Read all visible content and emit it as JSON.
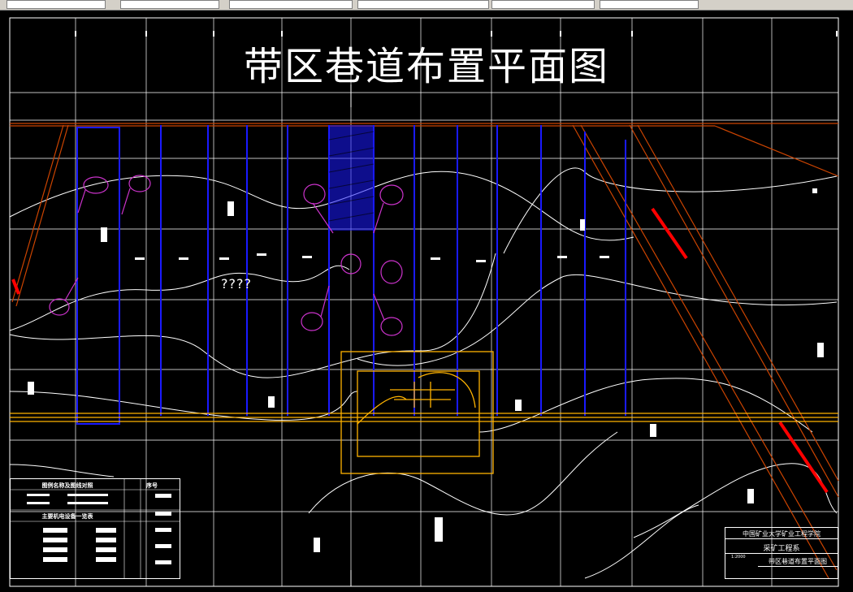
{
  "drawing": {
    "title": "带区巷道布置平面图",
    "question_marks": "????"
  },
  "legend": {
    "heading": "图例名称及图线对照",
    "subheading": "主要机电设备一览表",
    "col_header": "序号"
  },
  "title_block": {
    "institution": "中国矿业大学矿业工程学院",
    "department": "采矿工程系",
    "drawing_name": "带区巷道布置平面图",
    "scale": "1:2000"
  },
  "colors": {
    "background": "#000000",
    "grid": "#ffffff",
    "roadway": "#1a1aff",
    "belt": "#ffb300",
    "fault": "#cc4400",
    "highlight": "#ff0000",
    "callout": "#cc33cc"
  }
}
